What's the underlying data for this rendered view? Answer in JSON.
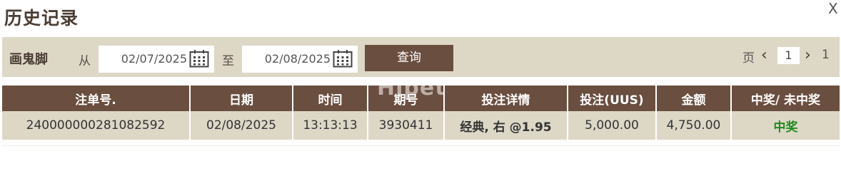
{
  "title": "历史记录",
  "close_label": "X",
  "filter": {
    "game_name": "画鬼脚",
    "from_label": "从",
    "from_date": "02/07/2025",
    "to_label": "至",
    "to_date": "02/08/2025",
    "query_label": "查询",
    "page_label": "页",
    "current_page": "1",
    "total_pages": "1",
    "prev_icon": "chevron-left",
    "next_icon": "chevron-right"
  },
  "table": {
    "headers": [
      "注单号.",
      "日期",
      "时间",
      "期号",
      "投注详情",
      "投注(UUS)",
      "金额",
      "中奖/ 未中奖"
    ],
    "rows": [
      {
        "ticket": "240000000281082592",
        "date": "02/08/2025",
        "time": "13:13:13",
        "period": "3930411",
        "bet_detail": "经典, 右 @1.95",
        "stake": "5,000.00",
        "amount": "4,750.00",
        "result": "中奖"
      }
    ]
  },
  "watermark": "Hipet",
  "colors": {
    "header_bg": "#6a4e3f",
    "bar_bg": "#ddd7c6",
    "win_text": "#1f8a1f",
    "title_text": "#4a3e35"
  }
}
